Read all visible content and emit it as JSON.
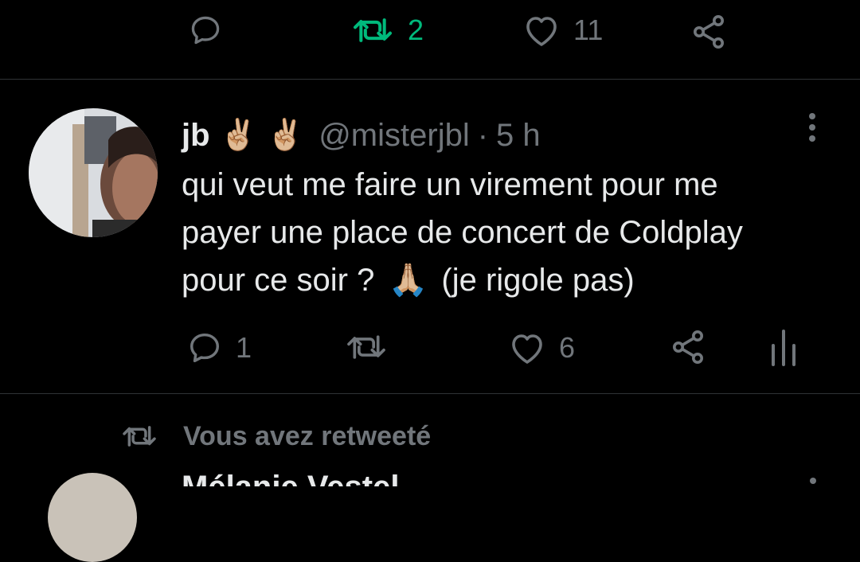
{
  "colors": {
    "background": "#000000",
    "text_primary": "#e7e9ea",
    "text_secondary": "#71767b",
    "retweet_active": "#00ba7c",
    "divider": "#2f3336"
  },
  "previous_tweet_actions": {
    "reply_icon": "reply-icon",
    "retweet_icon": "retweet-icon",
    "retweet_count": "2",
    "like_icon": "heart-icon",
    "like_count": "11",
    "share_icon": "share-icon"
  },
  "tweet": {
    "display_name": "jb",
    "name_emojis": [
      "✌🏼",
      "✌🏼"
    ],
    "handle": "@misterjbl",
    "separator": "·",
    "time": "5 h",
    "text_line1": "qui veut me faire un virement pour me",
    "text_line2": "payer une place de concert de Coldplay",
    "text_line3_before": "pour ce soir ?",
    "text_emoji": "🙏🏼",
    "text_line3_after": "(je rigole pas)",
    "reply_count": "1",
    "like_count": "6",
    "icons": [
      "reply-icon",
      "retweet-icon",
      "heart-icon",
      "share-icon",
      "analytics-icon",
      "more-vertical-icon"
    ]
  },
  "retweet_context": {
    "icon": "retweet-icon",
    "label": "Vous avez retweeté"
  },
  "next_tweet": {
    "display_name_partial": "Mélanie Vestel"
  }
}
